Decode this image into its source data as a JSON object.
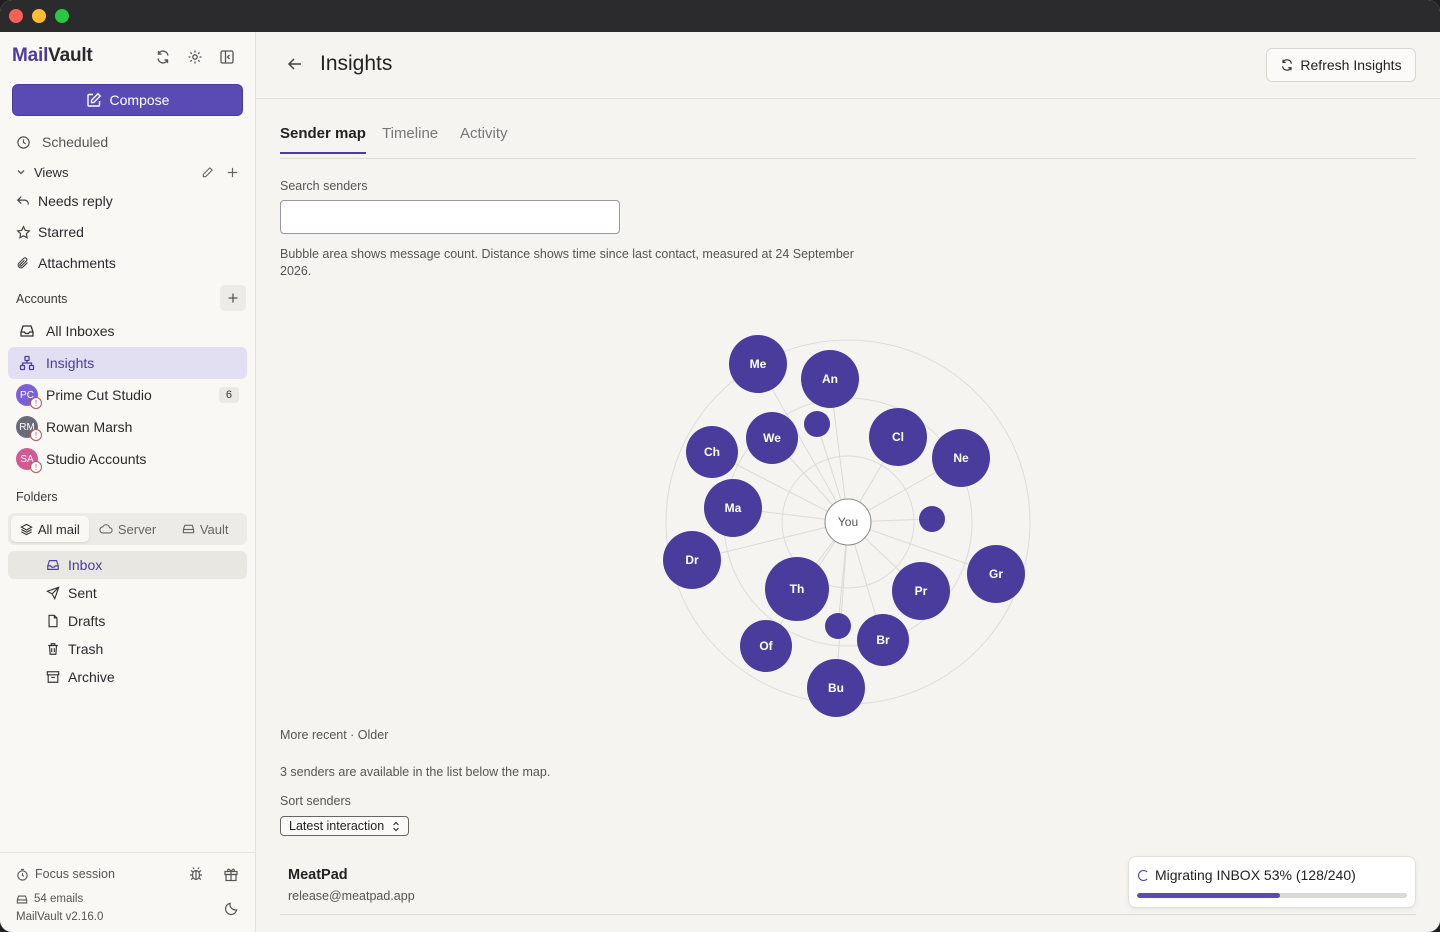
{
  "app": {
    "brand_prefix": "Mail",
    "brand_suffix": "Vault"
  },
  "sidebar": {
    "compose_label": "Compose",
    "scheduled_label": "Scheduled",
    "views_label": "Views",
    "views": [
      "Needs reply",
      "Starred",
      "Attachments"
    ],
    "accounts_label": "Accounts",
    "accounts": [
      {
        "label": "All Inboxes"
      },
      {
        "label": "Insights"
      },
      {
        "label": "Prime Cut Studio",
        "initials": "PC",
        "badge": "6",
        "color": "#7b61d6"
      },
      {
        "label": "Rowan Marsh",
        "initials": "RM",
        "color": "#6b6b78"
      },
      {
        "label": "Studio Accounts",
        "initials": "SA",
        "color": "#d25a94"
      }
    ],
    "folders_label": "Folders",
    "folder_scopes": [
      "All mail",
      "Server",
      "Vault"
    ],
    "folders": [
      "Inbox",
      "Sent",
      "Drafts",
      "Trash",
      "Archive"
    ],
    "footer": {
      "focus_label": "Focus session",
      "email_count": "54 emails",
      "version": "MailVault v2.16.0"
    }
  },
  "header": {
    "title": "Insights",
    "refresh_label": "Refresh Insights"
  },
  "tabs": [
    "Sender map",
    "Timeline",
    "Activity"
  ],
  "search": {
    "label": "Search senders",
    "value": ""
  },
  "description": "Bubble area shows message count. Distance shows time since last contact, measured at 24 September 2026.",
  "map": {
    "center_label": "You",
    "bubbles": [
      "Me",
      "An",
      "",
      "We",
      "Cl",
      "Ch",
      "Ne",
      "Ma",
      "",
      "Dr",
      "Gr",
      "Th",
      "Pr",
      "",
      "Br",
      "Of",
      "Bu"
    ],
    "accent": "#4a3c9c"
  },
  "legend_text": "More recent · Older",
  "senders_note": "3 senders are available in the list below the map.",
  "sort": {
    "label": "Sort senders",
    "value": "Latest interaction"
  },
  "sender_list": [
    {
      "name": "MeatPad",
      "email": "release@meatpad.app"
    }
  ],
  "toast": {
    "text": "Migrating INBOX 53% (128/240)",
    "progress": 0.53
  }
}
